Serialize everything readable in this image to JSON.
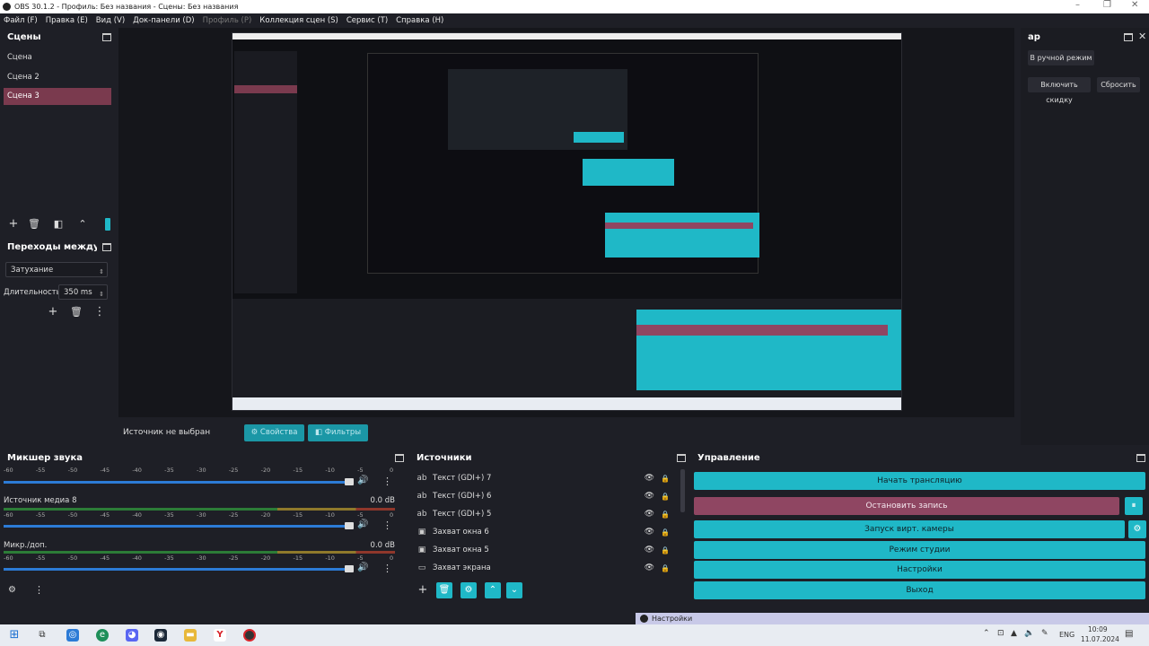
{
  "window": {
    "title": "OBS 30.1.2 - Профиль: Без названия - Сцены: Без названия"
  },
  "menu": [
    {
      "label": "Файл (F)",
      "disabled": false
    },
    {
      "label": "Правка (E)",
      "disabled": false
    },
    {
      "label": "Вид (V)",
      "disabled": false
    },
    {
      "label": "Док-панели (D)",
      "disabled": false
    },
    {
      "label": "Профиль (P)",
      "disabled": true
    },
    {
      "label": "Коллекция сцен (S)",
      "disabled": false
    },
    {
      "label": "Сервис (T)",
      "disabled": false
    },
    {
      "label": "Справка (H)",
      "disabled": false
    }
  ],
  "scenes": {
    "title": "Сцены",
    "items": [
      "Сцена",
      "Сцена 2",
      "Сцена 3"
    ],
    "selected_index": 2
  },
  "transitions": {
    "title": "Переходы между ...",
    "type": "Затухание",
    "duration_label": "Длительность",
    "duration_value": "350 ms"
  },
  "studio_panel": {
    "title": "ар",
    "manual_mode": "В ручной режим",
    "enable_discount": "Включить скидку",
    "reset": "Сбросить"
  },
  "source_bar": {
    "status": "Источник не выбран",
    "properties": "Свойства",
    "filters": "Фильтры"
  },
  "mixer": {
    "title": "Микшер звука",
    "scale": [
      "-60",
      "-55",
      "-50",
      "-45",
      "-40",
      "-35",
      "-30",
      "-25",
      "-20",
      "-15",
      "-10",
      "-5",
      "0"
    ],
    "channels": [
      {
        "name": "",
        "db": ""
      },
      {
        "name": "Источник медиа 8",
        "db": "0.0 dB"
      },
      {
        "name": "Микр./доп.",
        "db": "0.0 dB"
      }
    ]
  },
  "sources": {
    "title": "Источники",
    "items": [
      {
        "label": "Текст (GDI+) 7",
        "icon": "text-icon"
      },
      {
        "label": "Текст (GDI+) 6",
        "icon": "text-icon"
      },
      {
        "label": "Текст (GDI+) 5",
        "icon": "text-icon"
      },
      {
        "label": "Захват окна 6",
        "icon": "window-icon"
      },
      {
        "label": "Захват окна 5",
        "icon": "window-icon"
      },
      {
        "label": "Захват экрана",
        "icon": "monitor-icon"
      }
    ]
  },
  "controls": {
    "title": "Управление",
    "start_stream": "Начать трансляцию",
    "stop_record": "Остановить запись",
    "virtual_cam": "Запуск вирт. камеры",
    "studio_mode": "Режим студии",
    "settings": "Настройки",
    "exit": "Выход"
  },
  "notification": {
    "label": "Настройки"
  },
  "taskbar": {
    "lang": "ENG",
    "time": "10:09",
    "date": "11.07.2024"
  },
  "colors": {
    "accent": "#1fb8c7",
    "record": "#8f4662",
    "selected_scene": "#7a3a4e",
    "background": "#1e1f26"
  }
}
